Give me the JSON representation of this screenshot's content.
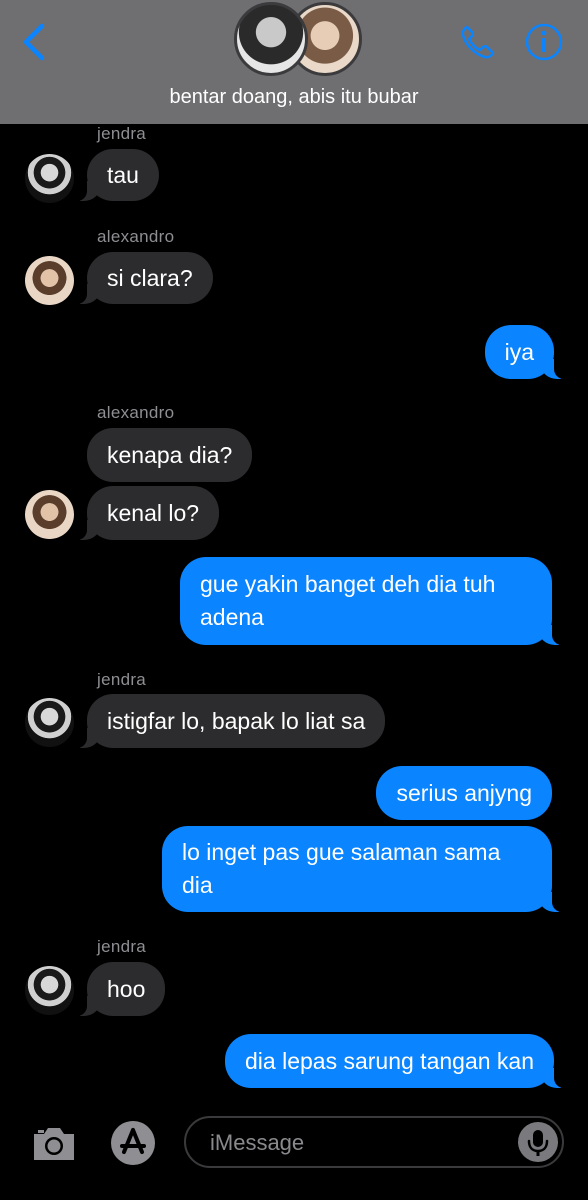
{
  "header": {
    "group_name": "bentar doang, abis itu bubar"
  },
  "colors": {
    "accent": "#0a84ff",
    "incoming_bubble": "#2c2c2e",
    "header_bg": "#6f6f72"
  },
  "messages": [
    {
      "sender": "jendra",
      "text": "tau"
    },
    {
      "sender": "alexandro",
      "text": "si clara?"
    },
    {
      "text": "iya"
    },
    {
      "sender": "alexandro",
      "text": "kenapa dia?"
    },
    {
      "text": "kenal lo?"
    },
    {
      "text": "gue yakin banget deh dia tuh adena"
    },
    {
      "sender": "jendra",
      "text": "istigfar lo, bapak lo liat sa"
    },
    {
      "text": "serius anjyng"
    },
    {
      "text": "lo inget pas gue salaman sama dia"
    },
    {
      "sender": "jendra",
      "text": "hoo"
    },
    {
      "text": "dia lepas sarung tangan kan"
    }
  ],
  "composer": {
    "placeholder": "iMessage"
  },
  "icons": [
    "back-chevron-icon",
    "phone-icon",
    "info-icon",
    "camera-icon",
    "app-store-icon",
    "microphone-icon"
  ]
}
